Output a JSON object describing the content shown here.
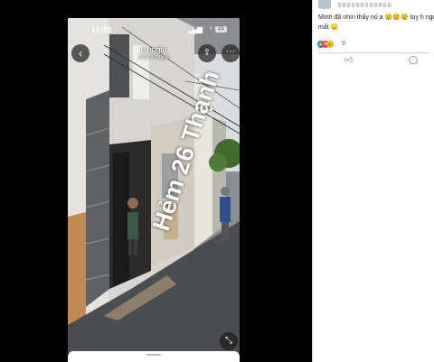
{
  "status_bar": {
    "time": "11:45",
    "battery": "21"
  },
  "street_view": {
    "title": "Google",
    "subtitle": "2022 Google",
    "street_sign": "Hẻm 26 Thạnh"
  },
  "post": {
    "comment_line1": "Mình đã nhìn thấy nó ạ 😢😢😢 tuy h ngoại",
    "comment_line2": "mất 😞",
    "reaction_count": "9",
    "icons": {
      "back": "chevron-left-icon",
      "share": "share-icon",
      "more": "more-icon",
      "expand": "collapse-icon",
      "like": "thumbs-up-icon",
      "comment": "comment-icon"
    }
  },
  "colors": {
    "facebook_blue": "#1877f2",
    "love_red": "#f33e58",
    "wow_yellow": "#f7b125"
  }
}
